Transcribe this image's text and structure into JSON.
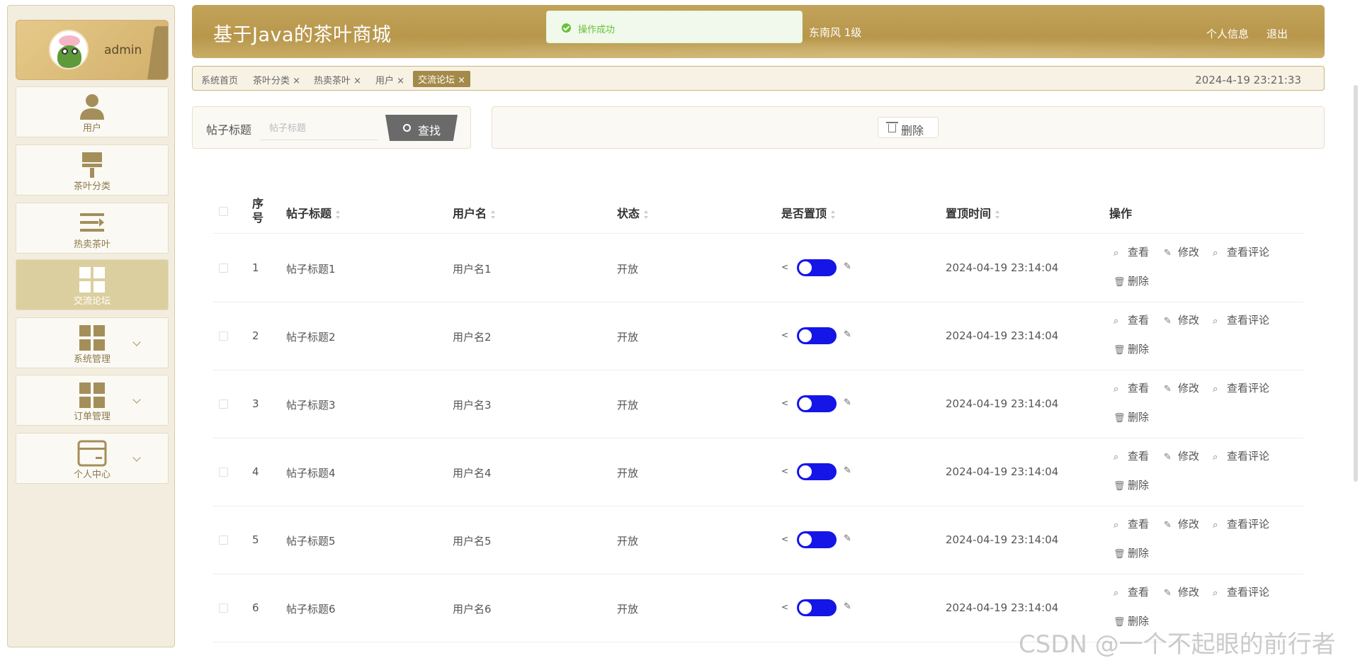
{
  "app": {
    "title": "基于Java的茶叶商城",
    "user_level": "东南风  1级",
    "profile_link": "个人信息",
    "logout_link": "退出"
  },
  "toast": {
    "message": "操作成功"
  },
  "sidebar": {
    "username": "admin",
    "items": [
      {
        "label": "用户",
        "icon": "user-icon"
      },
      {
        "label": "茶叶分类",
        "icon": "brush-icon"
      },
      {
        "label": "热卖茶叶",
        "icon": "list-icon"
      },
      {
        "label": "交流论坛",
        "icon": "grid-icon",
        "active": true
      },
      {
        "label": "系统管理",
        "icon": "grid-icon"
      },
      {
        "label": "订单管理",
        "icon": "grid-icon"
      },
      {
        "label": "个人中心",
        "icon": "card-icon"
      }
    ]
  },
  "tabs": {
    "items": [
      "系统首页",
      "茶叶分类 ×",
      "热卖茶叶 ×",
      "用户 ×",
      "交流论坛 ×"
    ],
    "clock": "2024-4-19 23:21:33"
  },
  "search": {
    "label": "帖子标题",
    "placeholder": "帖子标题",
    "button": "查找"
  },
  "actions": {
    "delete": "删除"
  },
  "table": {
    "headers": {
      "seq": "序\n号",
      "title": "帖子标题",
      "username": "用户名",
      "status": "状态",
      "pinned": "是否置顶",
      "pin_time": "置顶时间",
      "ops": "操作"
    },
    "op_labels": {
      "view": "查看",
      "edit": "修改",
      "comments": "查看评论",
      "delete": "删除"
    },
    "rows": [
      {
        "seq": "1",
        "title": "帖子标题1",
        "username": "用户名1",
        "status": "开放",
        "pinned": true,
        "pin_time": "2024-04-19 23:14:04"
      },
      {
        "seq": "2",
        "title": "帖子标题2",
        "username": "用户名2",
        "status": "开放",
        "pinned": true,
        "pin_time": "2024-04-19 23:14:04"
      },
      {
        "seq": "3",
        "title": "帖子标题3",
        "username": "用户名3",
        "status": "开放",
        "pinned": true,
        "pin_time": "2024-04-19 23:14:04"
      },
      {
        "seq": "4",
        "title": "帖子标题4",
        "username": "用户名4",
        "status": "开放",
        "pinned": true,
        "pin_time": "2024-04-19 23:14:04"
      },
      {
        "seq": "5",
        "title": "帖子标题5",
        "username": "用户名5",
        "status": "开放",
        "pinned": true,
        "pin_time": "2024-04-19 23:14:04"
      },
      {
        "seq": "6",
        "title": "帖子标题6",
        "username": "用户名6",
        "status": "开放",
        "pinned": true,
        "pin_time": "2024-04-19 23:14:04"
      }
    ]
  },
  "watermark": "CSDN @一个不起眼的前行者",
  "colors": {
    "accent": "#b8974c",
    "switch_on": "#1515e8",
    "success": "#67c23a"
  }
}
